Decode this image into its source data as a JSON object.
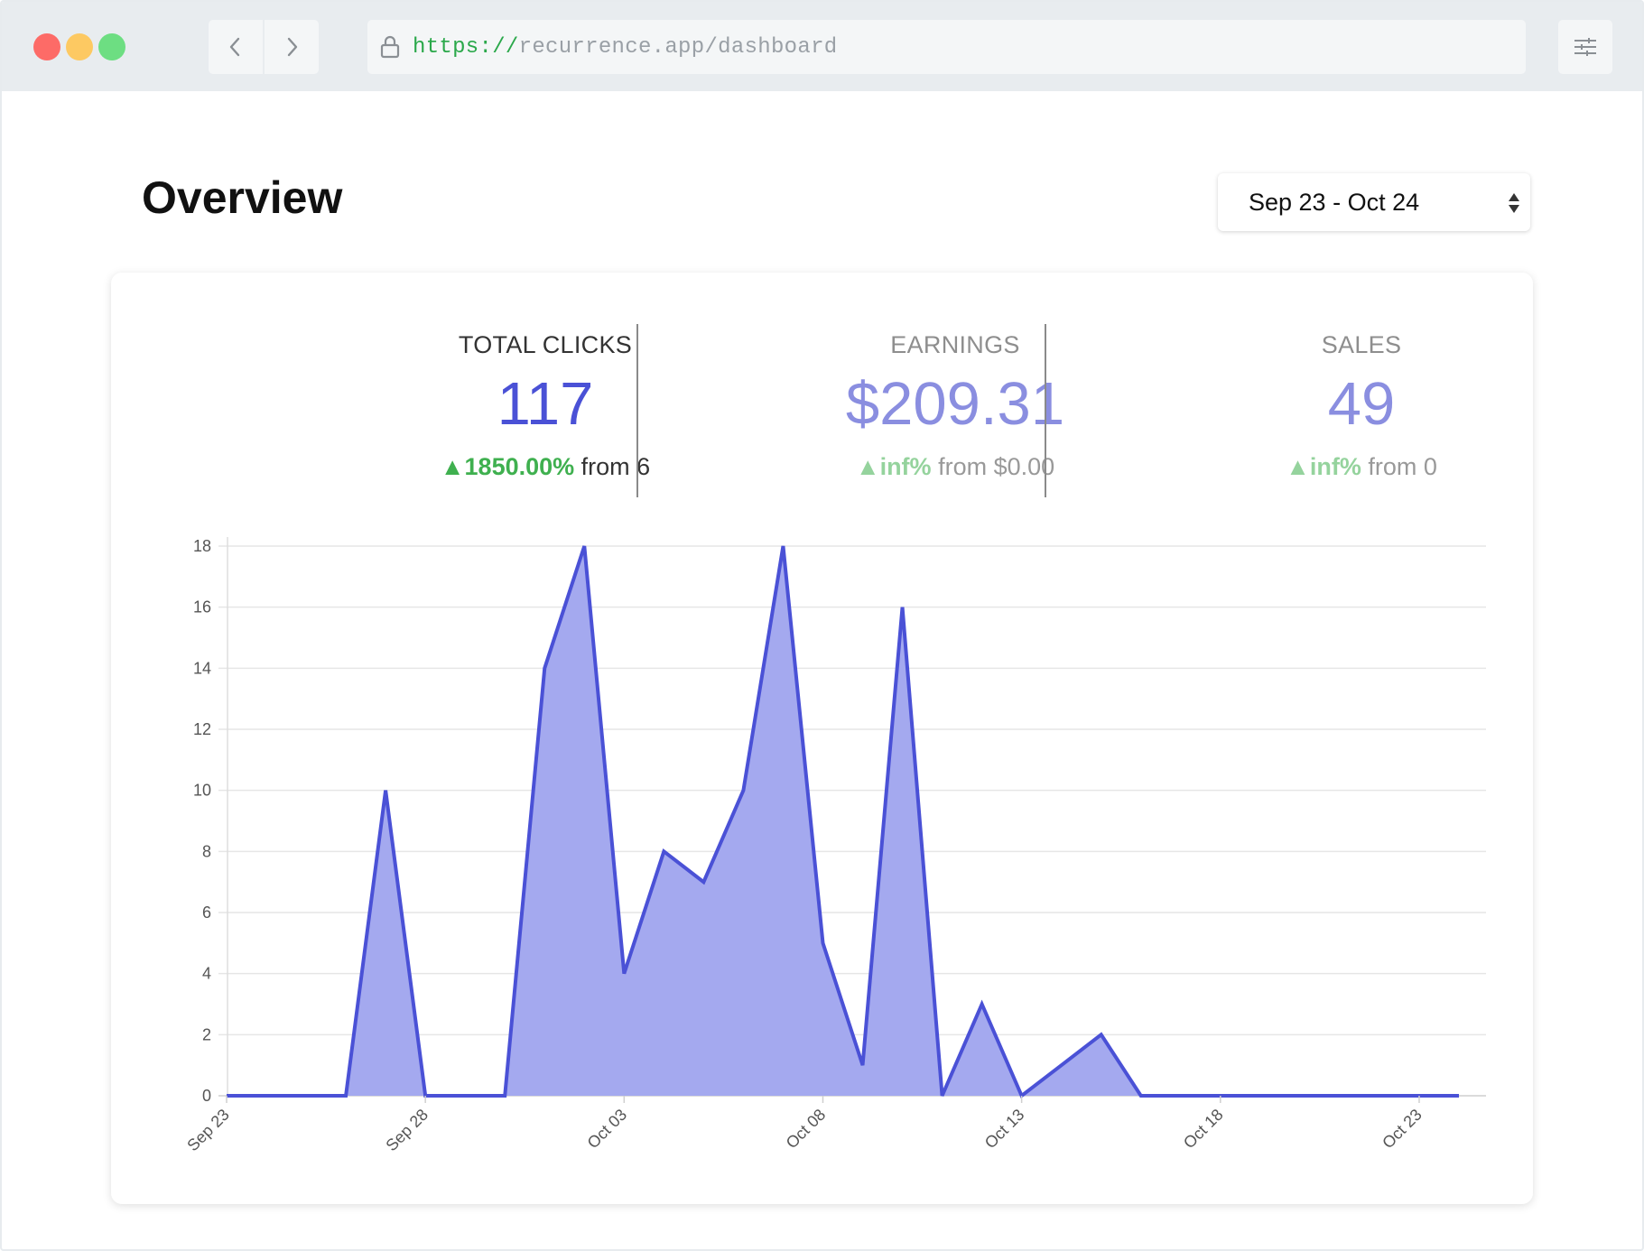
{
  "browser": {
    "url_scheme": "https://",
    "url_rest": "recurrence.app/dashboard"
  },
  "page": {
    "title": "Overview"
  },
  "date_range": {
    "selected": "Sep 23 - Oct 24"
  },
  "stats": [
    {
      "label": "TOTAL CLICKS",
      "value": "117",
      "delta": "1850.00%",
      "from": "from 6"
    },
    {
      "label": "EARNINGS",
      "value": "$209.31",
      "delta": "inf%",
      "from": "from $0.00"
    },
    {
      "label": "SALES",
      "value": "49",
      "delta": "inf%",
      "from": "from 0"
    }
  ],
  "colors": {
    "accent": "#4a51d6",
    "area_fill": "#a4a9ef",
    "positive": "#3fb04f"
  },
  "chart_data": {
    "type": "area",
    "x": [
      "Sep 23",
      "Sep 24",
      "Sep 25",
      "Sep 26",
      "Sep 27",
      "Sep 28",
      "Sep 29",
      "Sep 30",
      "Oct 01",
      "Oct 02",
      "Oct 03",
      "Oct 04",
      "Oct 05",
      "Oct 06",
      "Oct 07",
      "Oct 08",
      "Oct 09",
      "Oct 10",
      "Oct 11",
      "Oct 12",
      "Oct 13",
      "Oct 14",
      "Oct 15",
      "Oct 16",
      "Oct 17",
      "Oct 18",
      "Oct 19",
      "Oct 20",
      "Oct 21",
      "Oct 22",
      "Oct 23",
      "Oct 24"
    ],
    "values": [
      0,
      0,
      0,
      0,
      10,
      0,
      0,
      0,
      14,
      18,
      4,
      8,
      7,
      10,
      18,
      5,
      1,
      16,
      0,
      3,
      0,
      1,
      2,
      0,
      0,
      0,
      0,
      0,
      0,
      0,
      0,
      0
    ],
    "tick_labels_x": [
      "Sep 23",
      "Sep 28",
      "Oct 03",
      "Oct 08",
      "Oct 13",
      "Oct 18",
      "Oct 23"
    ],
    "tick_labels_y": [
      "0",
      "2",
      "4",
      "6",
      "8",
      "10",
      "12",
      "14",
      "16",
      "18"
    ],
    "ylim": [
      0,
      18
    ],
    "grid": true,
    "legend": "none"
  }
}
